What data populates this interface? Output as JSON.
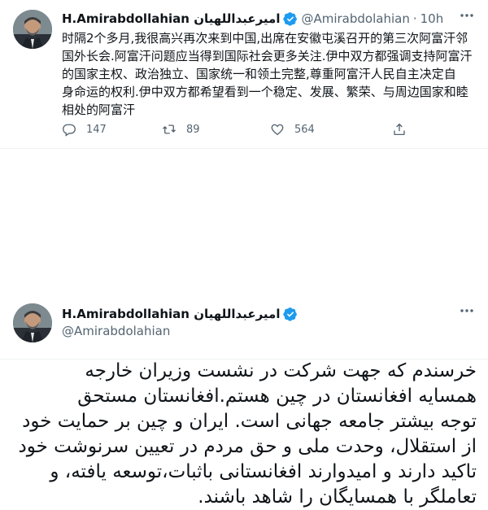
{
  "tweet1": {
    "author_name": "H.Amirabdollahian امیرعبداللهیان",
    "handle": "@Amirabdolahian",
    "separator": "·",
    "time": "10h",
    "text": "时隔2个多月,我很高兴再次来到中国,出席在安徽屯溪召开的第三次阿富汗邻\n国外长会.阿富汗问题应当得到国际社会更多关注.伊中双方都强调支持阿富汗\n的国家主权、政治独立、国家统一和领土完整,尊重阿富汗人民自主决定自\n身命运的权利.伊中双方都希望看到一个稳定、发展、繁荣、与周边国家和睦\n相处的阿富汗",
    "replies": "147",
    "retweets": "89",
    "likes": "564",
    "icons": {
      "verified": "verified-badge-icon",
      "more": "more-options-icon",
      "reply": "reply-icon",
      "retweet": "retweet-icon",
      "like": "like-icon",
      "share": "share-icon"
    }
  },
  "tweet2": {
    "author_name": "H.Amirabdollahian امیرعبداللهیان",
    "handle": "@Amirabdolahian",
    "text": "خرسندم که جهت شرکت در نشست وزیران خارجه\nهمسایه افغانستان در چین هستم.افغانستان مستحق\nتوجه بیشتر جامعه جهانی است. ایران و چین بر حمایت خود\nاز استقلال، وحدت ملی و حق مردم در تعیین سرنوشت خود\nتاکید دارند و امیدوارند افغانستانی باثبات،توسعه یافته، و\nتعاملگر با همسایگان را شاهد باشند."
  },
  "colors": {
    "verified": "#1d9bf0",
    "secondary_text": "#536471",
    "primary_text": "#0f1419",
    "divider": "#eff3f4"
  }
}
